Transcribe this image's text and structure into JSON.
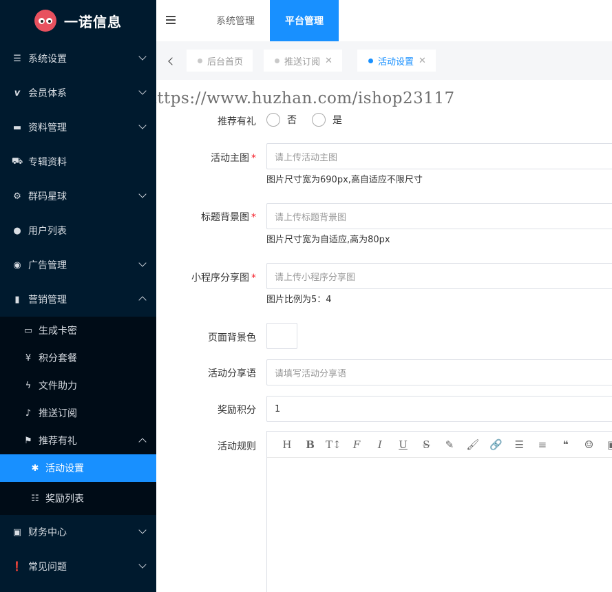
{
  "app": {
    "name": "一诺信息"
  },
  "sidebar": {
    "items": [
      {
        "label": "系统设置",
        "icon": "sliders-icon"
      },
      {
        "label": "会员体系",
        "icon": "vip-icon"
      },
      {
        "label": "资料管理",
        "icon": "folder-icon"
      },
      {
        "label": "专辑资料",
        "icon": "cart-icon"
      },
      {
        "label": "群码星球",
        "icon": "gears-icon"
      },
      {
        "label": "用户列表",
        "icon": "user-icon"
      },
      {
        "label": "广告管理",
        "icon": "ad-icon"
      },
      {
        "label": "营销管理",
        "icon": "bookmark-icon"
      }
    ],
    "marketing_sub": [
      {
        "label": "生成卡密",
        "icon": "card-icon"
      },
      {
        "label": "积分套餐",
        "icon": "yen-icon"
      },
      {
        "label": "文件助力",
        "icon": "bolt-icon"
      },
      {
        "label": "推送订阅",
        "icon": "bell-icon"
      },
      {
        "label": "推荐有礼",
        "icon": "flag-icon"
      }
    ],
    "referral_sub": [
      {
        "label": "活动设置",
        "icon": "asterisk-icon"
      },
      {
        "label": "奖励列表",
        "icon": "list-icon"
      }
    ],
    "bottom_items": [
      {
        "label": "财务中心",
        "icon": "money-icon"
      },
      {
        "label": "常见问题",
        "icon": "info-icon"
      }
    ]
  },
  "header": {
    "tabs": [
      {
        "label": "系统管理"
      },
      {
        "label": "平台管理"
      }
    ]
  },
  "tags": [
    {
      "label": "后台首页"
    },
    {
      "label": "推送订阅"
    },
    {
      "label": "活动设置"
    }
  ],
  "watermark": "https://www.huzhan.com/ishop23117",
  "form": {
    "recommend": {
      "label": "推荐有礼",
      "options": [
        "否",
        "是"
      ]
    },
    "main_image": {
      "label": "活动主图",
      "placeholder": "请上传活动主图",
      "hint": "图片尺寸宽为690px,高自适应不限尺寸"
    },
    "title_bg": {
      "label": "标题背景图",
      "placeholder": "请上传标题背景图",
      "hint": "图片尺寸宽为自适应,高为80px"
    },
    "share_image": {
      "label": "小程序分享图",
      "placeholder": "请上传小程序分享图",
      "hint": "图片比例为5：4"
    },
    "page_bg": {
      "label": "页面背景色"
    },
    "share_text": {
      "label": "活动分享语",
      "placeholder": "请填写活动分享语"
    },
    "points": {
      "label": "奖励积分",
      "value": "1"
    },
    "rules": {
      "label": "活动规则"
    }
  },
  "editor_toolbar": [
    "H",
    "B",
    "T↕",
    "F",
    "I",
    "U",
    "S",
    "✎",
    "🖌",
    "🔗",
    "☰",
    "≡",
    "❝",
    "☺",
    "▣"
  ],
  "colors": {
    "accent": "#1890ff",
    "sidebar": "#001a2e",
    "required": "#f5222d"
  }
}
